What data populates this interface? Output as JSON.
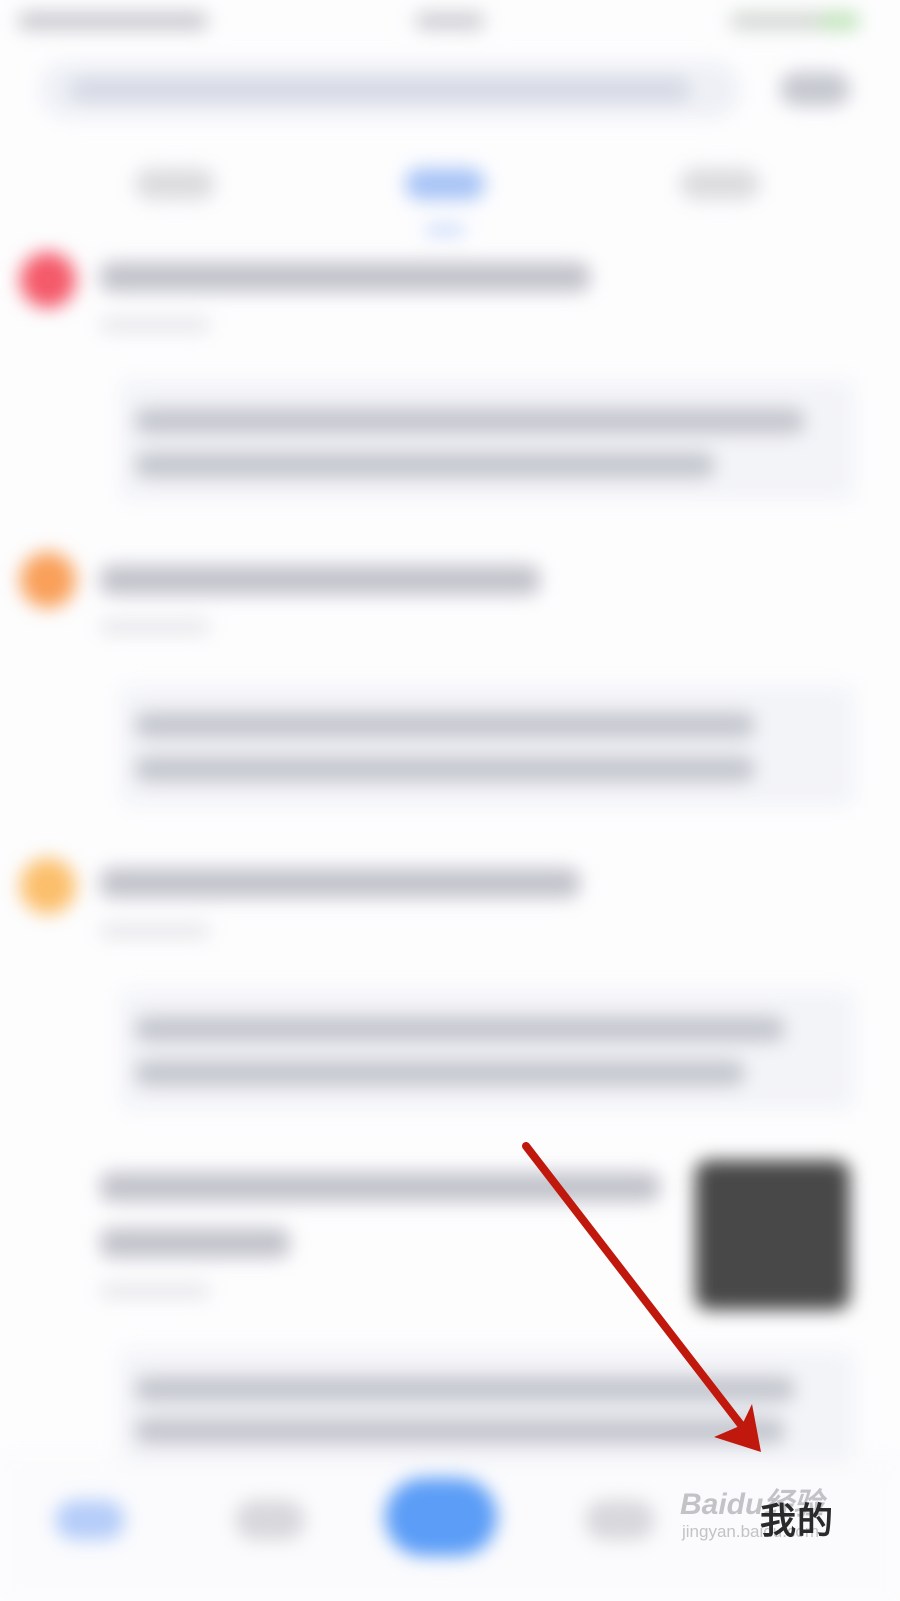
{
  "tabbar": {
    "mine_label": "我的"
  },
  "watermark": {
    "logo": "Baidu经验",
    "url": "jingyan.baidu.com"
  },
  "colors": {
    "accent_blue": "#5b9df7",
    "arrow_red": "#c0180c",
    "rank_1": "#f45a6a",
    "rank_2": "#f9a05a",
    "rank_3": "#fbbf6c"
  }
}
